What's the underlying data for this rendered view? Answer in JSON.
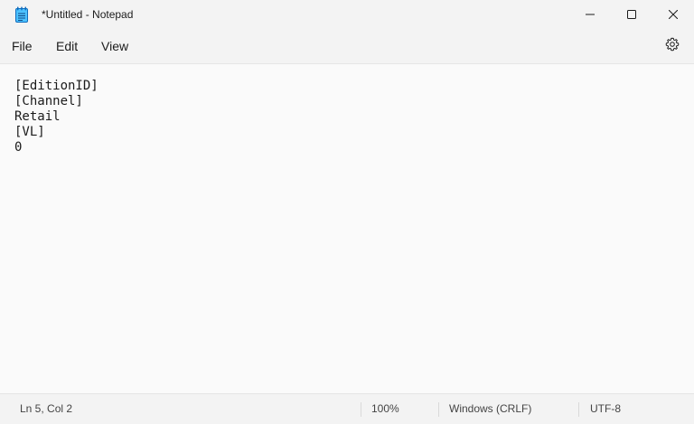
{
  "window": {
    "title": "*Untitled - Notepad"
  },
  "icons": {
    "app": "notepad-icon",
    "minimize": "minimize-icon",
    "maximize": "maximize-icon",
    "close": "close-icon",
    "settings": "gear-icon"
  },
  "menu": {
    "file": "File",
    "edit": "Edit",
    "view": "View"
  },
  "editor": {
    "content": "[EditionID]\n[Channel]\nRetail\n[VL]\n0"
  },
  "status": {
    "position": "Ln 5, Col 2",
    "zoom": "100%",
    "line_ending": "Windows (CRLF)",
    "encoding": "UTF-8"
  },
  "colors": {
    "accent_icon": "#2b88d8",
    "editor_bg": "#fafafa",
    "chrome_bg": "#f3f3f3"
  }
}
